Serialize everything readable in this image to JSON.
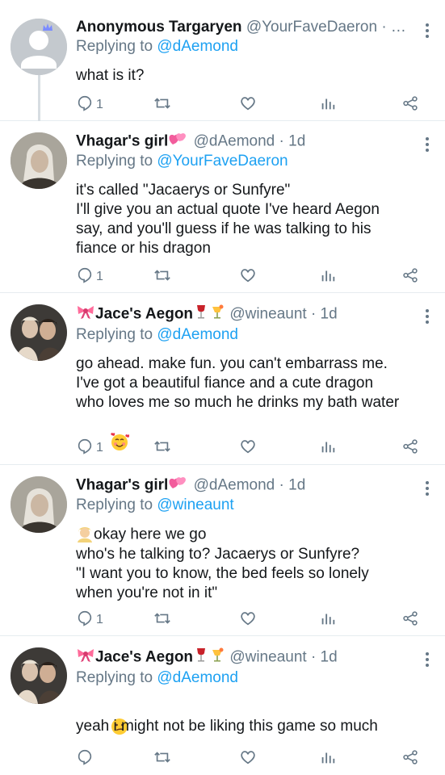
{
  "tweets": [
    {
      "name": "Anonymous Targaryen",
      "handle": "@YourFaveDaeron",
      "meta": " · …",
      "replying_to_label": "Replying to",
      "replying_to": "@dAemond",
      "lines": [
        "what is it?"
      ],
      "reply_count": "1",
      "avatar": "default-avatar"
    },
    {
      "name": "Vhagar's girl",
      "handle": "@dAemond",
      "meta": " · 1d",
      "replying_to_label": "Replying to",
      "replying_to": "@YourFaveDaeron",
      "lines": [
        "it's called \"Jacaerys or Sunfyre\"",
        "I'll give you an actual quote I've heard Aegon",
        "say, and you'll guess if he was talking to his",
        "fiance or his dragon"
      ],
      "reply_count": "1",
      "avatar": "white-haired-man-photo"
    },
    {
      "name": "Jace's Aegon",
      "handle": "@wineaunt",
      "meta": " · 1d",
      "replying_to_label": "Replying to",
      "replying_to": "@dAemond",
      "lines": [
        "go ahead. make fun. you can't embarrass me.",
        "I've got a beautiful fiance and a cute dragon",
        "who loves me so much he drinks my bath water"
      ],
      "reply_count": "1",
      "avatar": "two-people-photo"
    },
    {
      "name": "Vhagar's girl",
      "handle": "@dAemond",
      "meta": " · 1d",
      "replying_to_label": "Replying to",
      "replying_to": "@wineaunt",
      "lines": [
        "okay here we go",
        "who's he talking to? Jacaerys or Sunfyre?",
        "\"I want you to know, the bed feels so lonely",
        "when you're not in it\""
      ],
      "reply_count": "1",
      "avatar": "white-haired-man-photo"
    },
    {
      "name": "Jace's Aegon",
      "handle": "@wineaunt",
      "meta": " · 1d",
      "replying_to_label": "Replying to",
      "replying_to": "@dAemond",
      "lines": [
        "yeah i might not be liking this game so much"
      ],
      "reply_count": "",
      "avatar": "two-people-photo"
    }
  ],
  "colors": {
    "link": "#1da1f2",
    "secondary": "#657786",
    "text": "#14171a",
    "line": "#d7dde2"
  }
}
